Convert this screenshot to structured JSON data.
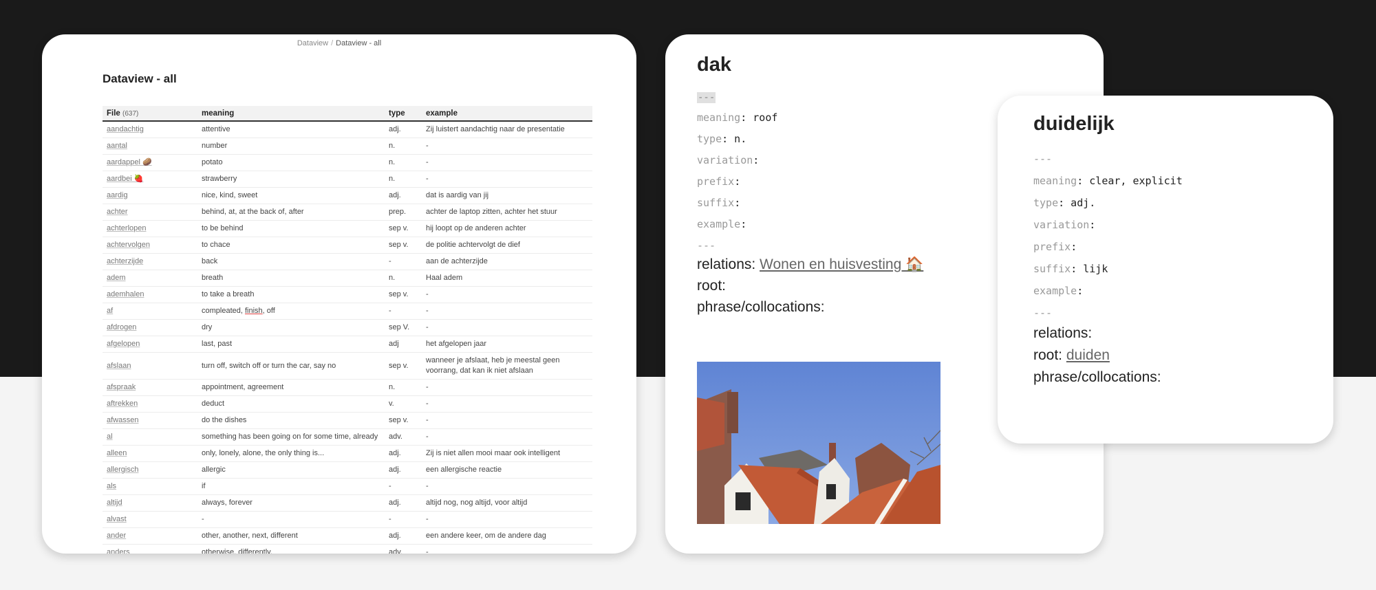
{
  "breadcrumb": {
    "parent": "Dataview",
    "separator": "/",
    "current": "Dataview - all"
  },
  "dataview": {
    "title": "Dataview - all",
    "headers": {
      "file": "File",
      "count": "(637)",
      "meaning": "meaning",
      "type": "type",
      "example": "example"
    },
    "rows": [
      {
        "file": "aandachtig",
        "meaning": "attentive",
        "type": "adj.",
        "example": "Zij luistert aandachtig naar de presentatie"
      },
      {
        "file": "aantal",
        "meaning": "number",
        "type": "n.",
        "example": "-"
      },
      {
        "file": "aardappel 🥔",
        "meaning": "potato",
        "type": "n.",
        "example": "-"
      },
      {
        "file": "aardbei 🍓",
        "meaning": "strawberry",
        "type": "n.",
        "example": "-"
      },
      {
        "file": "aardig",
        "meaning": "nice, kind, sweet",
        "type": "adj.",
        "example": "dat is aardig van jij"
      },
      {
        "file": "achter",
        "meaning": "behind, at, at the back of, after",
        "type": "prep.",
        "example": "achter de laptop zitten, achter het stuur"
      },
      {
        "file": "achterlopen",
        "meaning": "to be behind",
        "type": "sep v.",
        "example": "hij loopt op de anderen achter"
      },
      {
        "file": "achtervolgen",
        "meaning": "to chace",
        "type": "sep v.",
        "example": "de politie achtervolgt de dief"
      },
      {
        "file": "achterzijde",
        "meaning": "back",
        "type": "-",
        "example": "aan de achterzijde"
      },
      {
        "file": "adem",
        "meaning": "breath",
        "type": "n.",
        "example": "Haal adem"
      },
      {
        "file": "ademhalen",
        "meaning": "to take a breath",
        "type": "sep v.",
        "example": "-"
      },
      {
        "file": "af",
        "meaning": "compleated, finish, off",
        "type": "-",
        "example": "-"
      },
      {
        "file": "afdrogen",
        "meaning": "dry",
        "type": "sep V.",
        "example": "-"
      },
      {
        "file": "afgelopen",
        "meaning": "last, past",
        "type": "adj",
        "example": "het afgelopen jaar"
      },
      {
        "file": "afslaan",
        "meaning": "turn off, switch off or turn the car, say no",
        "type": "sep v.",
        "example": "wanneer je afslaat, heb je meestal geen voorrang, dat kan ik niet afslaan"
      },
      {
        "file": "afspraak",
        "meaning": "appointment, agreement",
        "type": "n.",
        "example": "-"
      },
      {
        "file": "aftrekken",
        "meaning": "deduct",
        "type": "v.",
        "example": "-"
      },
      {
        "file": "afwassen",
        "meaning": "do the dishes",
        "type": "sep v.",
        "example": "-"
      },
      {
        "file": "al",
        "meaning": "something has been going on for some time, already",
        "type": "adv.",
        "example": "-"
      },
      {
        "file": "alleen",
        "meaning": "only, lonely, alone, the only thing is...",
        "type": "adj.",
        "example": "Zij is niet allen mooi maar ook intelligent"
      },
      {
        "file": "allergisch",
        "meaning": "allergic",
        "type": "adj.",
        "example": "een allergische reactie"
      },
      {
        "file": "als",
        "meaning": "if",
        "type": "-",
        "example": "-"
      },
      {
        "file": "altijd",
        "meaning": "always, forever",
        "type": "adj.",
        "example": "altijd nog, nog altijd, voor altijd"
      },
      {
        "file": "alvast",
        "meaning": "-",
        "type": "-",
        "example": "-"
      },
      {
        "file": "ander",
        "meaning": "other, another, next, different",
        "type": "adj.",
        "example": "een andere keer, om de andere dag"
      },
      {
        "file": "anders",
        "meaning": "otherwise, differently,",
        "type": "adv.",
        "example": "-"
      }
    ]
  },
  "note_dak": {
    "title": "dak",
    "dash": "---",
    "meaning_key": "meaning",
    "meaning_val": " roof",
    "type_key": "type",
    "type_val": " n.",
    "variation_key": "variation",
    "variation_val": "",
    "prefix_key": "prefix",
    "prefix_val": "",
    "suffix_key": "suffix",
    "suffix_val": "",
    "example_key": "example",
    "example_val": "",
    "relations_label": "relations: ",
    "relations_link": "Wonen en huisvesting 🏠",
    "root_label": "root:",
    "phrase_label": "phrase/collocations:"
  },
  "note_duidelijk": {
    "title": "duidelijk",
    "dash": "---",
    "meaning_key": "meaning",
    "meaning_val": " clear, explicit",
    "type_key": "type",
    "type_val": " adj.",
    "variation_key": "variation",
    "variation_val": "",
    "prefix_key": "prefix",
    "prefix_val": "",
    "suffix_key": "suffix",
    "suffix_val": " lijk",
    "example_key": "example",
    "example_val": "",
    "relations_label": "relations:",
    "root_label": "root: ",
    "root_link": "duiden",
    "phrase_label": "phrase/collocations:"
  },
  "colors": {
    "dark_bg": "#1a1a1a",
    "light_bg": "#f4f4f4",
    "sky": "#6f8fd6",
    "roof_tile": "#c45a38"
  }
}
